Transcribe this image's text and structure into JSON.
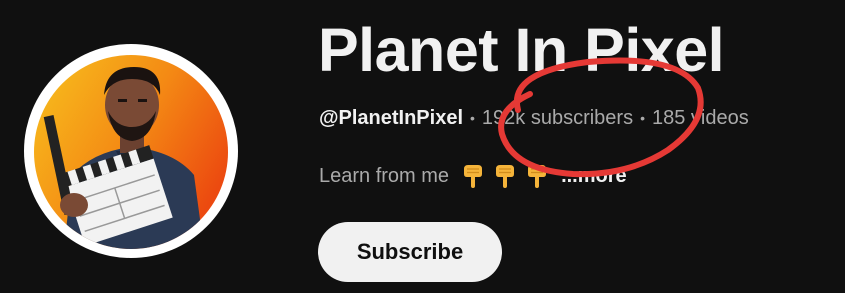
{
  "channel": {
    "title": "Planet In Pixel",
    "handle": "@PlanetInPixel",
    "subscribers": "192k subscribers",
    "videos": "185 videos",
    "separator": "•",
    "description": "Learn from me",
    "description_emojis": [
      "pointing-down-hand-icon",
      "pointing-down-hand-icon",
      "pointing-down-hand-icon"
    ],
    "more_label": "...more"
  },
  "actions": {
    "subscribe_label": "Subscribe"
  },
  "annotation": {
    "shape": "red-hand-drawn-circle",
    "target": "subscribers-count",
    "color": "#e53935"
  },
  "colors": {
    "background": "#101010",
    "primary_text": "#f1f1f1",
    "secondary_text": "#aaaaaa",
    "button_bg": "#f1f1f1",
    "button_text": "#0f0f0f",
    "avatar_gradient_start": "#f7b21a",
    "avatar_gradient_end": "#ee4f12"
  }
}
